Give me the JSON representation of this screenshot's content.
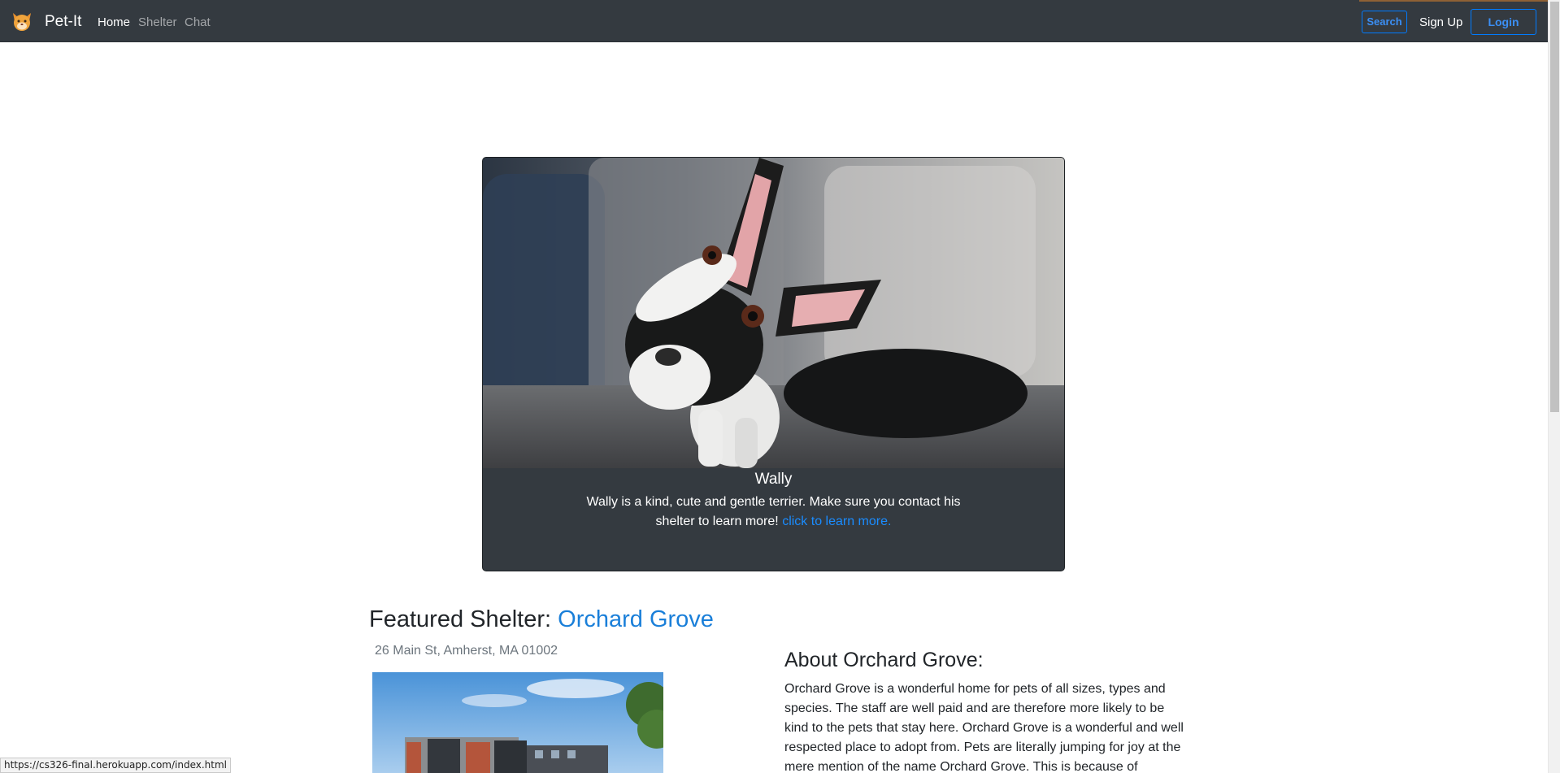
{
  "navbar": {
    "brand": "Pet-It",
    "links": [
      {
        "label": "Home",
        "active": true
      },
      {
        "label": "Shelter",
        "active": false
      },
      {
        "label": "Chat",
        "active": false
      }
    ],
    "search_label": "Search",
    "signup_label": "Sign Up",
    "login_label": "Login",
    "icon": "cat-face-icon"
  },
  "carousel": {
    "image": "dog-photo",
    "title": "Wally",
    "text": "Wally is a kind, cute and gentle terrier. Make sure you contact his shelter to learn more!",
    "link_text": "click to learn more."
  },
  "featured": {
    "prefix": "Featured Shelter: ",
    "name": "Orchard Grove",
    "address": "26 Main St, Amherst, MA 01002",
    "image": "shelter-building-photo"
  },
  "about": {
    "title": "About Orchard Grove:",
    "text": "Orchard Grove is a wonderful home for pets of all sizes, types and species. The staff are well paid and are therefore more likely to be kind to the pets that stay here. Orchard Grove is a wonderful and well respected place to adopt from. Pets are literally jumping for joy at the mere mention of the name Orchard Grove. This is because of"
  },
  "status_bar": {
    "url": "https://cs326-final.herokuapp.com/index.html"
  },
  "colors": {
    "navbar_bg": "#343a40",
    "accent": "#007bff",
    "link": "#1a7fd9"
  }
}
